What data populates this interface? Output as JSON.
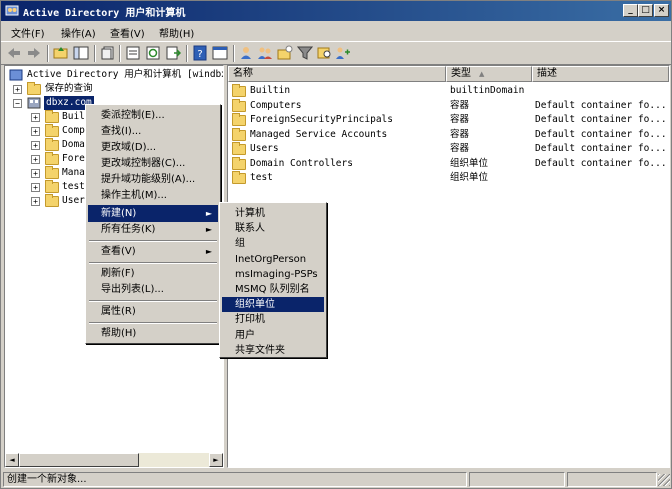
{
  "window": {
    "title": "Active Directory 用户和计算机",
    "minimize": "_",
    "maximize": "□",
    "close": "×"
  },
  "menubar": [
    "文件(F)",
    "操作(A)",
    "查看(V)",
    "帮助(H)"
  ],
  "tree": {
    "root": "Active Directory 用户和计算机 [windbxz",
    "saved_queries": "保存的查询",
    "domain": "dbxz.com",
    "children": [
      "Builtin",
      "Computers",
      "Domain Controllers",
      "ForeignSecurityPrincipals",
      "Managed Service Accounts",
      "test",
      "Users"
    ],
    "children_visible": [
      "Built",
      "Compu",
      "Domai",
      "Forei",
      "Manag",
      "test",
      "Users"
    ]
  },
  "list": {
    "headers": [
      "名称",
      "类型",
      "描述"
    ],
    "rows": [
      {
        "name": "Builtin",
        "type": "builtinDomain",
        "desc": ""
      },
      {
        "name": "Computers",
        "type": "容器",
        "desc": "Default container fo..."
      },
      {
        "name": "ForeignSecurityPrincipals",
        "type": "容器",
        "desc": "Default container fo..."
      },
      {
        "name": "Managed Service Accounts",
        "type": "容器",
        "desc": "Default container fo..."
      },
      {
        "name": "Users",
        "type": "容器",
        "desc": "Default container fo..."
      },
      {
        "name": "Domain Controllers",
        "type": "组织单位",
        "desc": "Default container fo..."
      },
      {
        "name": "test",
        "type": "组织单位",
        "desc": ""
      }
    ]
  },
  "context_menu": {
    "group1": [
      "委派控制(E)...",
      "查找(I)...",
      "更改域(D)...",
      "更改域控制器(C)...",
      "提升域功能级别(A)...",
      "操作主机(M)..."
    ],
    "new": "新建(N)",
    "all_tasks": "所有任务(K)",
    "view": "查看(V)",
    "refresh": "刷新(F)",
    "export": "导出列表(L)...",
    "properties": "属性(R)",
    "help": "帮助(H)"
  },
  "submenu": [
    "计算机",
    "联系人",
    "组",
    "InetOrgPerson",
    "msImaging-PSPs",
    "MSMQ 队列别名",
    "组织单位",
    "打印机",
    "用户",
    "共享文件夹"
  ],
  "submenu_highlight_index": 6,
  "status": {
    "text": "创建一个新对象..."
  }
}
